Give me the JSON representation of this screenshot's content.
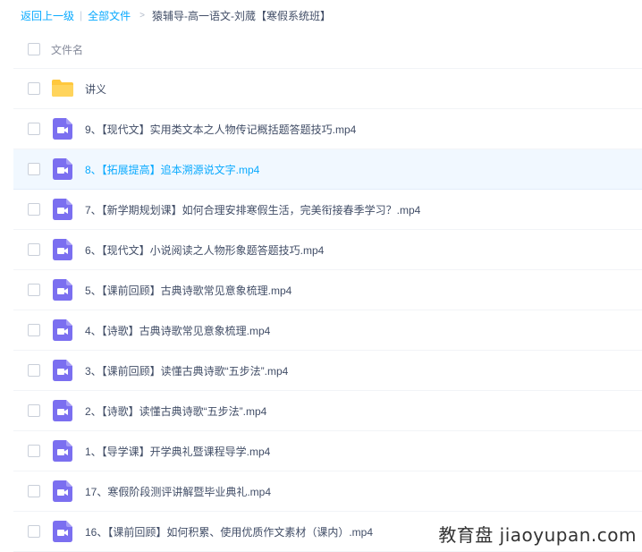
{
  "breadcrumb": {
    "back": "返回上一级",
    "all_files": "全部文件",
    "current": "猿辅导-高一语文-刘蒇【寒假系统班】"
  },
  "header": {
    "column_name": "文件名"
  },
  "files": [
    {
      "name": "讲义",
      "type": "folder"
    },
    {
      "name": "9、【现代文】实用类文本之人物传记概括题答题技巧.mp4",
      "type": "video"
    },
    {
      "name": "8、【拓展提高】追本溯源说文字.mp4",
      "type": "video",
      "highlighted": true
    },
    {
      "name": "7、【新学期规划课】如何合理安排寒假生活，完美衔接春季学习？.mp4",
      "type": "video"
    },
    {
      "name": "6、【现代文】小说阅读之人物形象题答题技巧.mp4",
      "type": "video"
    },
    {
      "name": "5、【课前回顾】古典诗歌常见意象梳理.mp4",
      "type": "video"
    },
    {
      "name": "4、【诗歌】古典诗歌常见意象梳理.mp4",
      "type": "video"
    },
    {
      "name": "3、【课前回顾】读懂古典诗歌“五步法”.mp4",
      "type": "video"
    },
    {
      "name": "2、【诗歌】读懂古典诗歌“五步法”.mp4",
      "type": "video"
    },
    {
      "name": "1、【导学课】开学典礼暨课程导学.mp4",
      "type": "video"
    },
    {
      "name": "17、寒假阶段测评讲解暨毕业典礼.mp4",
      "type": "video"
    },
    {
      "name": "16、【课前回顾】如何积累、使用优质作文素材（课内）.mp4",
      "type": "video"
    }
  ],
  "colors": {
    "link": "#09aaff",
    "video_icon": "#7b6ff0",
    "folder_icon": "#ffc83d"
  },
  "watermark": "教育盘 jiaoyupan.com"
}
